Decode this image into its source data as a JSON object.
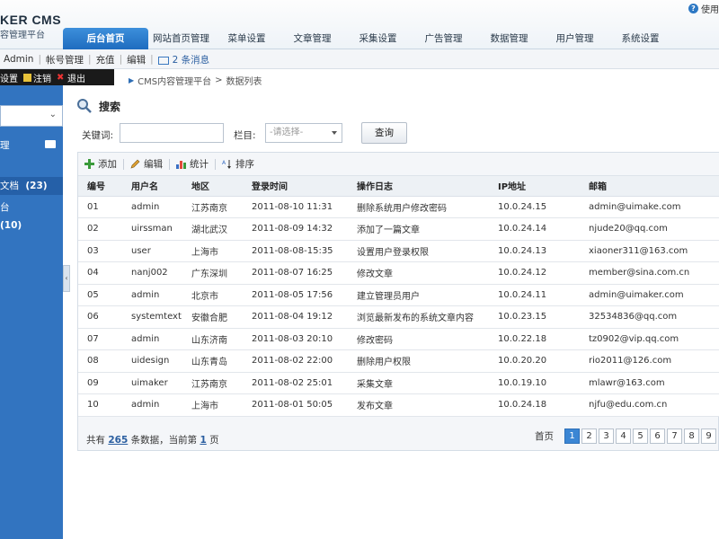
{
  "header": {
    "logo_title": "KER CMS",
    "logo_sub": "容管理平台",
    "help": "使用",
    "tabs": [
      "后台首页",
      "网站首页管理",
      "菜单设置",
      "文章管理",
      "采集设置",
      "广告管理",
      "数据管理",
      "用户管理",
      "系统设置"
    ]
  },
  "subbar": {
    "user": "Admin",
    "links": [
      "帐号管理",
      "充值",
      "编辑"
    ],
    "messages": "2 条消息"
  },
  "sidebar": {
    "actions": [
      "设置",
      "注销",
      "退出"
    ],
    "items": [
      "理",
      "文档",
      "(23)",
      "台",
      "(10)"
    ]
  },
  "breadcrumb": [
    "CMS内容管理平台",
    "数据列表"
  ],
  "search": {
    "title": "搜索",
    "keyword_label": "关键词:",
    "column_label": "栏目:",
    "column_placeholder": "-请选择-",
    "button": "查询"
  },
  "toolbar": {
    "add": "添加",
    "edit": "编辑",
    "stats": "统计",
    "sort": "排序"
  },
  "table": {
    "headers": [
      "编号",
      "用户名",
      "地区",
      "登录时间",
      "操作日志",
      "IP地址",
      "邮箱"
    ],
    "rows": [
      [
        "01",
        "admin",
        "江苏南京",
        "2011-08-10 11:31",
        "删除系统用户修改密码",
        "10.0.24.15",
        "admin@uimake.com"
      ],
      [
        "02",
        "uirssman",
        "湖北武汉",
        "2011-08-09 14:32",
        "添加了一篇文章",
        "10.0.24.14",
        "njude20@qq.com"
      ],
      [
        "03",
        "user",
        "上海市",
        "2011-08-08-15:35",
        "设置用户登录权限",
        "10.0.24.13",
        "xiaoner311@163.com"
      ],
      [
        "04",
        "nanj002",
        "广东深圳",
        "2011-08-07 16:25",
        "修改文章",
        "10.0.24.12",
        "member@sina.com.cn"
      ],
      [
        "05",
        "admin",
        "北京市",
        "2011-08-05 17:56",
        "建立管理员用户",
        "10.0.24.11",
        "admin@uimaker.com"
      ],
      [
        "06",
        "systemtext",
        "安徽合肥",
        "2011-08-04 19:12",
        "浏览最新发布的系统文章内容",
        "10.0.23.15",
        "32534836@qq.com"
      ],
      [
        "07",
        "admin",
        "山东济南",
        "2011-08-03 20:10",
        "修改密码",
        "10.0.22.18",
        "tz0902@vip.qq.com"
      ],
      [
        "08",
        "uidesign",
        "山东青岛",
        "2011-08-02 22:00",
        "删除用户权限",
        "10.0.20.20",
        "rio2011@126.com"
      ],
      [
        "09",
        "uimaker",
        "江苏南京",
        "2011-08-02 25:01",
        "采集文章",
        "10.0.19.10",
        "mlawr@163.com"
      ],
      [
        "10",
        "admin",
        "上海市",
        "2011-08-01 50:05",
        "发布文章",
        "10.0.24.18",
        "njfu@edu.com.cn"
      ]
    ]
  },
  "pagination": {
    "total_prefix": "共有",
    "total_count": "265",
    "total_mid": "条数据，当前第",
    "current": "1",
    "total_suffix": "页",
    "first": "首页",
    "pages": [
      "1",
      "2",
      "3",
      "4",
      "5",
      "6",
      "7",
      "8",
      "9"
    ]
  },
  "colors": {
    "accent": "#2d78c4",
    "sidebar": "#3274c0",
    "active_page": "#3b86d4"
  }
}
